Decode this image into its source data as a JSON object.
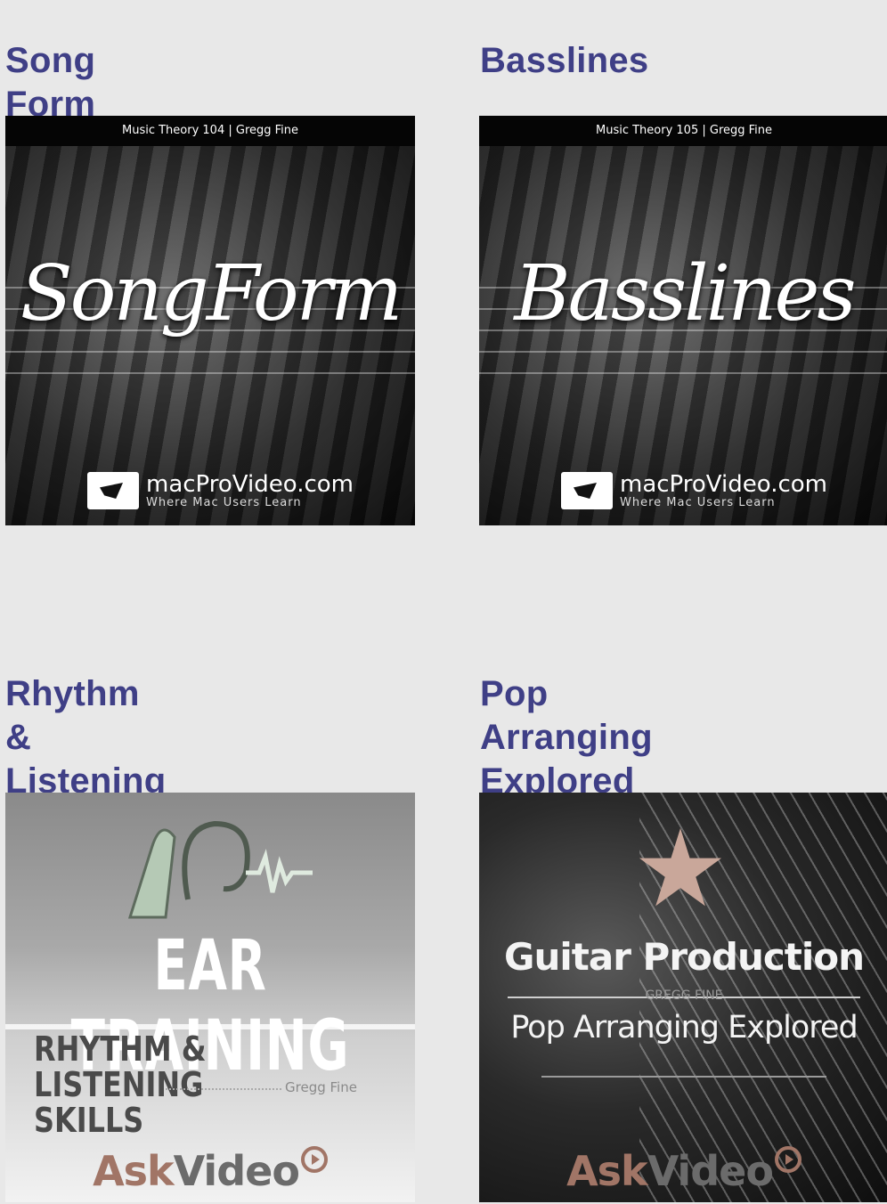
{
  "cards": [
    {
      "title": "Song Form",
      "cover_top": "Music Theory 104   |   Gregg Fine",
      "cover_title": "SongForm",
      "brand": "macProVideo.com",
      "brand_tagline": "Where Mac Users Learn"
    },
    {
      "title": "Basslines",
      "cover_top": "Music Theory 105   |   Gregg Fine",
      "cover_title": "Basslines",
      "brand": "macProVideo.com",
      "brand_tagline": "Where Mac Users Learn"
    },
    {
      "title": "Rhythm &\nListening Skills",
      "cover_title": "EAR TRAINING",
      "cover_subtitle": "RHYTHM & LISTENING\nSKILLS",
      "cover_author": "Gregg Fine",
      "brand_a": "Ask",
      "brand_b": "Video"
    },
    {
      "title": "Pop Arranging\nExplored",
      "cover_title": "Guitar Production",
      "cover_author": "GREGG FINE",
      "cover_subtitle": "Pop Arranging Explored",
      "brand_a": "Ask",
      "brand_b": "Video"
    }
  ]
}
